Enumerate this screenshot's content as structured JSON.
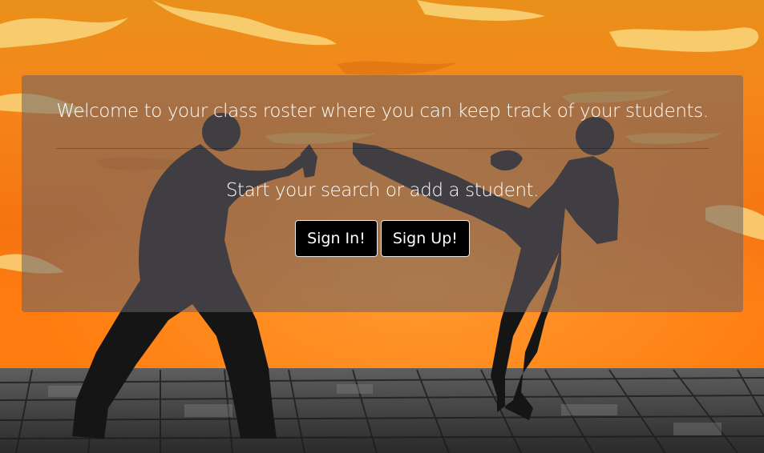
{
  "hero": {
    "lead_text": "Welcome to your class roster where you can keep track of your students.",
    "cta_text": "Start your search or add a student.",
    "buttons": {
      "sign_in": "Sign In!",
      "sign_up": "Sign Up!"
    }
  },
  "colors": {
    "sky_top": "#f7a21a",
    "sky_mid": "#f57a10",
    "sky_horizon": "#ff7a0a",
    "floor": "#4a4a4a",
    "silhouette": "#1a1a1a",
    "panel_overlay": "rgba(100,96,104,0.55)",
    "button_bg": "#000000",
    "text": "#ffffff"
  }
}
